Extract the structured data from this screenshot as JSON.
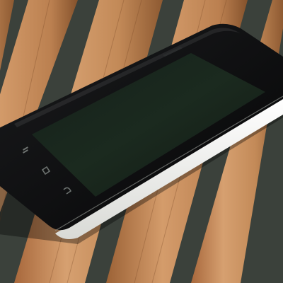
{
  "scene": {
    "subject": "smartphone",
    "surface": "wooden-slat-bench",
    "screen_state": "off"
  },
  "phone": {
    "nav_icons": [
      "menu-icon",
      "home-icon",
      "back-icon"
    ]
  },
  "palette": {
    "background": "#3a3f3a",
    "wood_light": "#d19a6a",
    "wood_mid": "#b97c4c",
    "wood_dark": "#8a5a34",
    "gap_shadow": "#2e342f",
    "phone_front": "#0e0f10",
    "screen": "#18221a",
    "phone_back": "#f2f2ef",
    "nav_icon": "#6d7270"
  }
}
